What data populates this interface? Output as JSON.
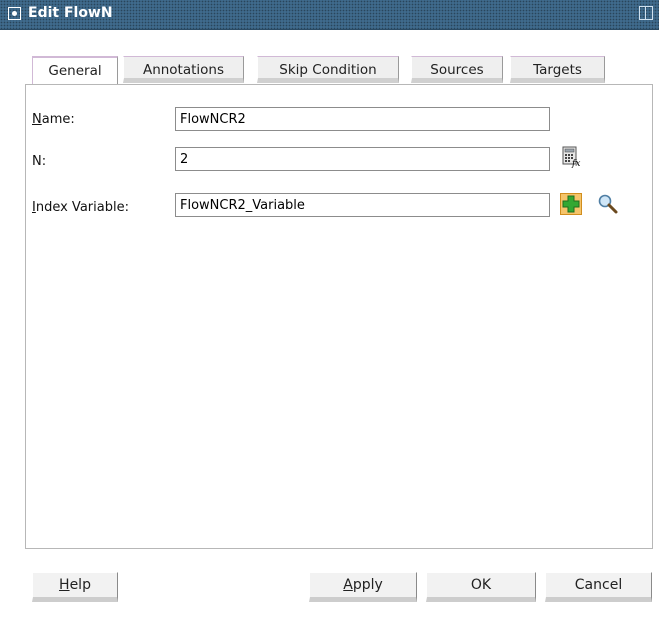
{
  "window": {
    "title": "Edit FlowN"
  },
  "tabs": [
    {
      "label": "General",
      "active": true
    },
    {
      "label": "Annotations",
      "active": false
    },
    {
      "label": "Skip Condition",
      "active": false
    },
    {
      "label": "Sources",
      "active": false
    },
    {
      "label": "Targets",
      "active": false
    }
  ],
  "form": {
    "name_label_mnemonic": "N",
    "name_label_rest": "ame:",
    "name_value": "FlowNCR2",
    "n_label": "N:",
    "n_value": "2",
    "index_label_mnemonic": "I",
    "index_label_rest": "ndex Variable:",
    "index_value": "FlowNCR2_Variable"
  },
  "icons": {
    "expression_builder": "expression-builder-icon",
    "add": "add-icon",
    "search": "search-icon"
  },
  "buttons": {
    "help_mnemonic": "H",
    "help_rest": "elp",
    "apply_mnemonic": "A",
    "apply_rest": "pply",
    "ok": "OK",
    "cancel": "Cancel"
  }
}
